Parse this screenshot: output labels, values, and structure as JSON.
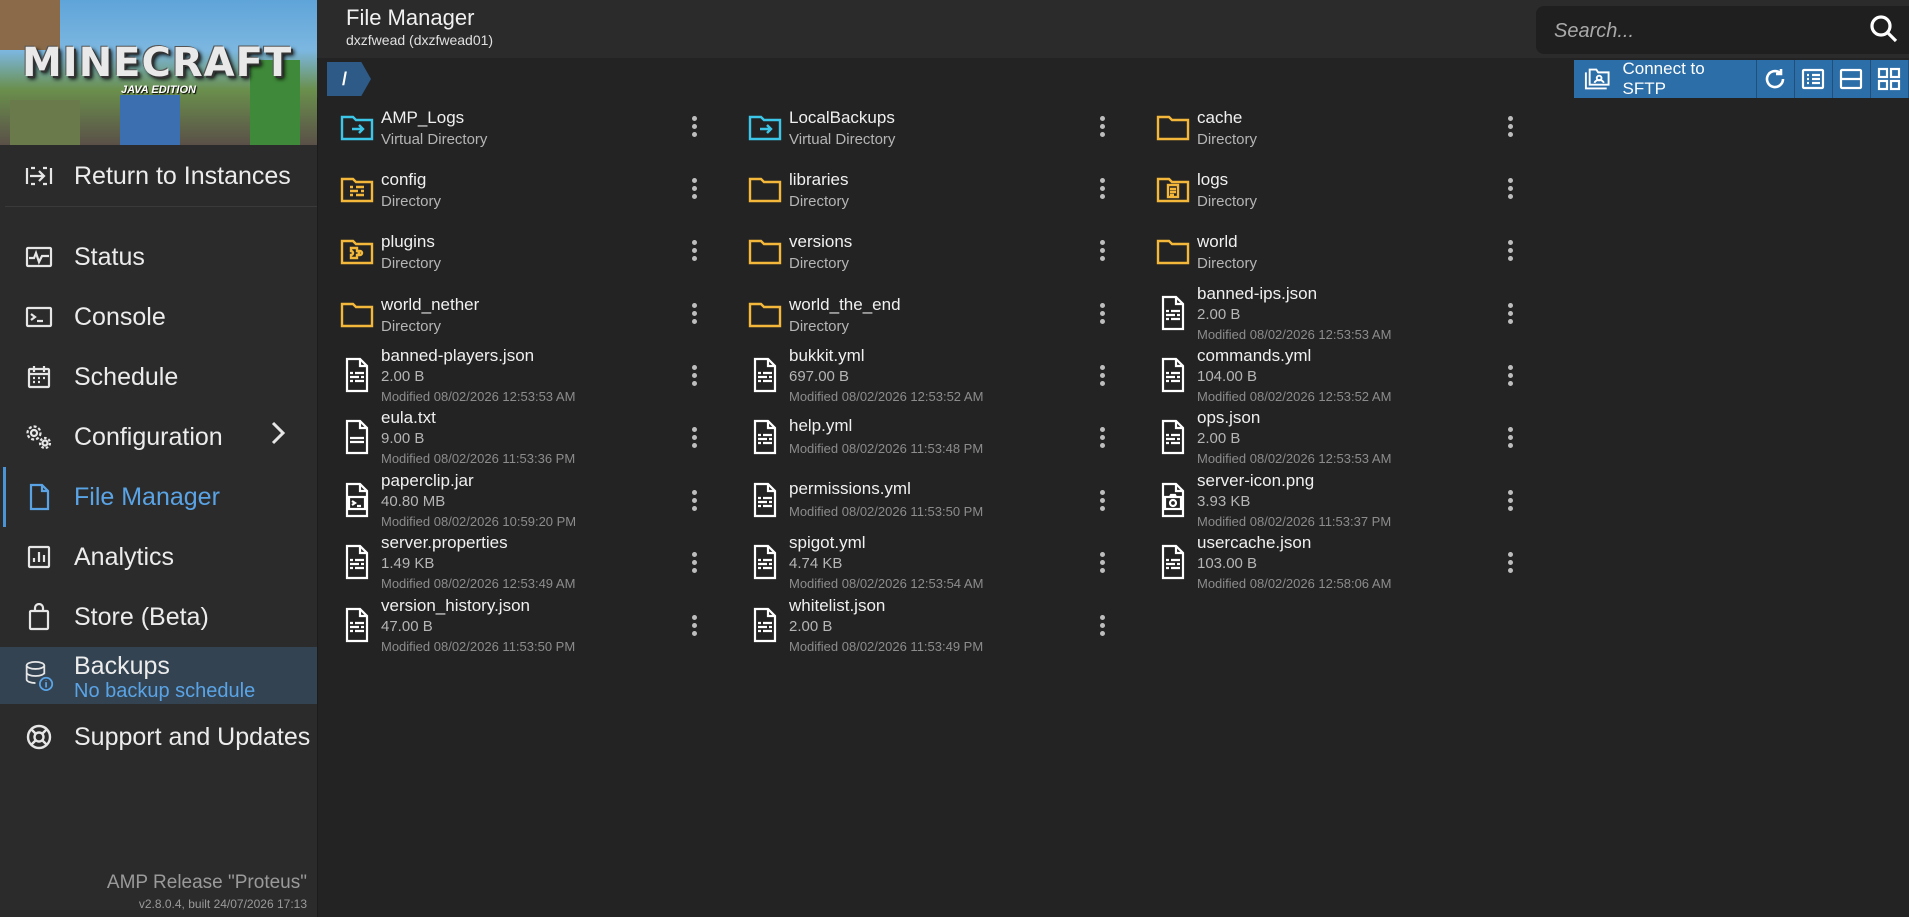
{
  "sidebar": {
    "banner": {
      "logo_text": "MINECRAFT",
      "edition_text": "JAVA EDITION"
    },
    "items": [
      {
        "label": "Return to Instances",
        "icon": "return-icon"
      },
      {
        "label": "Status",
        "icon": "status-icon"
      },
      {
        "label": "Console",
        "icon": "console-icon"
      },
      {
        "label": "Schedule",
        "icon": "calendar-icon"
      },
      {
        "label": "Configuration",
        "icon": "gear-icon"
      },
      {
        "label": "File Manager",
        "icon": "file-icon",
        "active": true
      },
      {
        "label": "Analytics",
        "icon": "analytics-icon"
      },
      {
        "label": "Store (Beta)",
        "icon": "shopping-bag-icon"
      },
      {
        "label": "Backups",
        "sublabel": "No backup schedule",
        "icon": "database-icon"
      },
      {
        "label": "Support and Updates",
        "icon": "lifebuoy-icon"
      }
    ],
    "footer": {
      "release": "AMP Release \"Proteus\"",
      "version": "v2.8.0.4, built 24/07/2026 17:13"
    }
  },
  "header": {
    "title": "File Manager",
    "subtitle": "dxzfwead (dxzfwead01)",
    "search": {
      "placeholder": "Search...",
      "value": ""
    }
  },
  "breadcrumb": {
    "path": "/"
  },
  "toolbar": {
    "sftp_label": "Connect to SFTP"
  },
  "colors": {
    "accent": "#2c6ea8",
    "folder": "#f3b73b",
    "virtual_dir": "#3cc6e8",
    "active_nav": "#5aa4e6"
  },
  "files": [
    {
      "name": "AMP_Logs",
      "info": "Virtual Directory",
      "modified": "",
      "type": "virtual"
    },
    {
      "name": "LocalBackups",
      "info": "Virtual Directory",
      "modified": "",
      "type": "virtual"
    },
    {
      "name": "cache",
      "info": "Directory",
      "modified": "",
      "type": "folder"
    },
    {
      "name": "config",
      "info": "Directory",
      "modified": "",
      "type": "folder-config"
    },
    {
      "name": "libraries",
      "info": "Directory",
      "modified": "",
      "type": "folder"
    },
    {
      "name": "logs",
      "info": "Directory",
      "modified": "",
      "type": "folder-doc"
    },
    {
      "name": "plugins",
      "info": "Directory",
      "modified": "",
      "type": "folder-plugin"
    },
    {
      "name": "versions",
      "info": "Directory",
      "modified": "",
      "type": "folder"
    },
    {
      "name": "world",
      "info": "Directory",
      "modified": "",
      "type": "folder"
    },
    {
      "name": "world_nether",
      "info": "Directory",
      "modified": "",
      "type": "folder"
    },
    {
      "name": "world_the_end",
      "info": "Directory",
      "modified": "",
      "type": "folder"
    },
    {
      "name": "banned-ips.json",
      "info": "2.00 B",
      "modified": "Modified 08/02/2026 12:53:53 AM",
      "type": "config-file"
    },
    {
      "name": "banned-players.json",
      "info": "2.00 B",
      "modified": "Modified 08/02/2026 12:53:53 AM",
      "type": "config-file"
    },
    {
      "name": "bukkit.yml",
      "info": "697.00 B",
      "modified": "Modified 08/02/2026 12:53:52 AM",
      "type": "config-file"
    },
    {
      "name": "commands.yml",
      "info": "104.00 B",
      "modified": "Modified 08/02/2026 12:53:52 AM",
      "type": "config-file"
    },
    {
      "name": "eula.txt",
      "info": "9.00 B",
      "modified": "Modified 08/02/2026 11:53:36 PM",
      "type": "text-file"
    },
    {
      "name": "help.yml",
      "info": "",
      "modified": "Modified 08/02/2026 11:53:48 PM",
      "type": "config-file"
    },
    {
      "name": "ops.json",
      "info": "2.00 B",
      "modified": "Modified 08/02/2026 12:53:53 AM",
      "type": "config-file"
    },
    {
      "name": "paperclip.jar",
      "info": "40.80 MB",
      "modified": "Modified 08/02/2026 10:59:20 PM",
      "type": "jar-file"
    },
    {
      "name": "permissions.yml",
      "info": "",
      "modified": "Modified 08/02/2026 11:53:50 PM",
      "type": "config-file"
    },
    {
      "name": "server-icon.png",
      "info": "3.93 KB",
      "modified": "Modified 08/02/2026 11:53:37 PM",
      "type": "image-file"
    },
    {
      "name": "server.properties",
      "info": "1.49 KB",
      "modified": "Modified 08/02/2026 12:53:49 AM",
      "type": "config-file"
    },
    {
      "name": "spigot.yml",
      "info": "4.74 KB",
      "modified": "Modified 08/02/2026 12:53:54 AM",
      "type": "config-file"
    },
    {
      "name": "usercache.json",
      "info": "103.00 B",
      "modified": "Modified 08/02/2026 12:58:06 AM",
      "type": "config-file"
    },
    {
      "name": "version_history.json",
      "info": "47.00 B",
      "modified": "Modified 08/02/2026 11:53:50 PM",
      "type": "config-file"
    },
    {
      "name": "whitelist.json",
      "info": "2.00 B",
      "modified": "Modified 08/02/2026 11:53:49 PM",
      "type": "config-file"
    }
  ]
}
